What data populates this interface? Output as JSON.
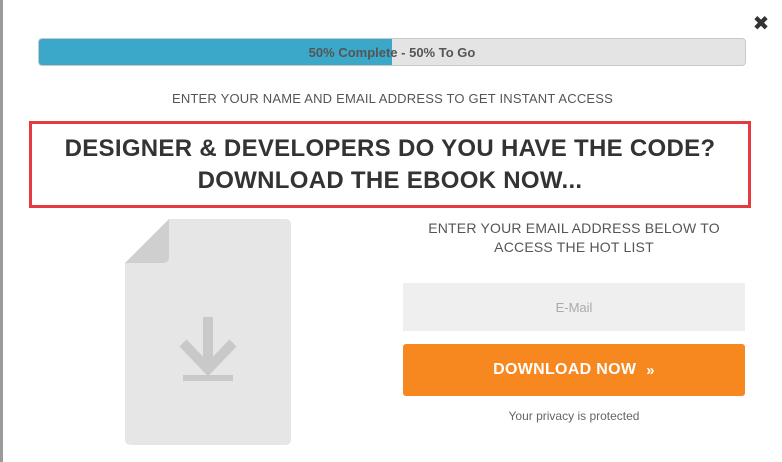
{
  "modal": {
    "close_glyph": "✖"
  },
  "progress": {
    "percent": 50,
    "label": "50% Complete - 50% To Go",
    "fill_color": "#3ba7c9"
  },
  "subhead": "ENTER YOUR NAME AND EMAIL ADDRESS TO GET INSTANT ACCESS",
  "headline": {
    "line1": "DESIGNER & DEVELOPERS DO YOU HAVE THE CODE?",
    "line2": "DOWNLOAD THE EBOOK NOW...",
    "border_color": "#e53a40"
  },
  "document_icon": "document-download-icon",
  "form": {
    "heading_line1": "ENTER YOUR EMAIL ADDRESS BELOW TO",
    "heading_line2": "ACCESS THE HOT LIST",
    "email_placeholder": "E-Mail",
    "email_value": "",
    "button_label": "DOWNLOAD NOW",
    "button_chevron": "»",
    "button_color": "#f7871f",
    "privacy_text": "Your privacy is protected"
  }
}
